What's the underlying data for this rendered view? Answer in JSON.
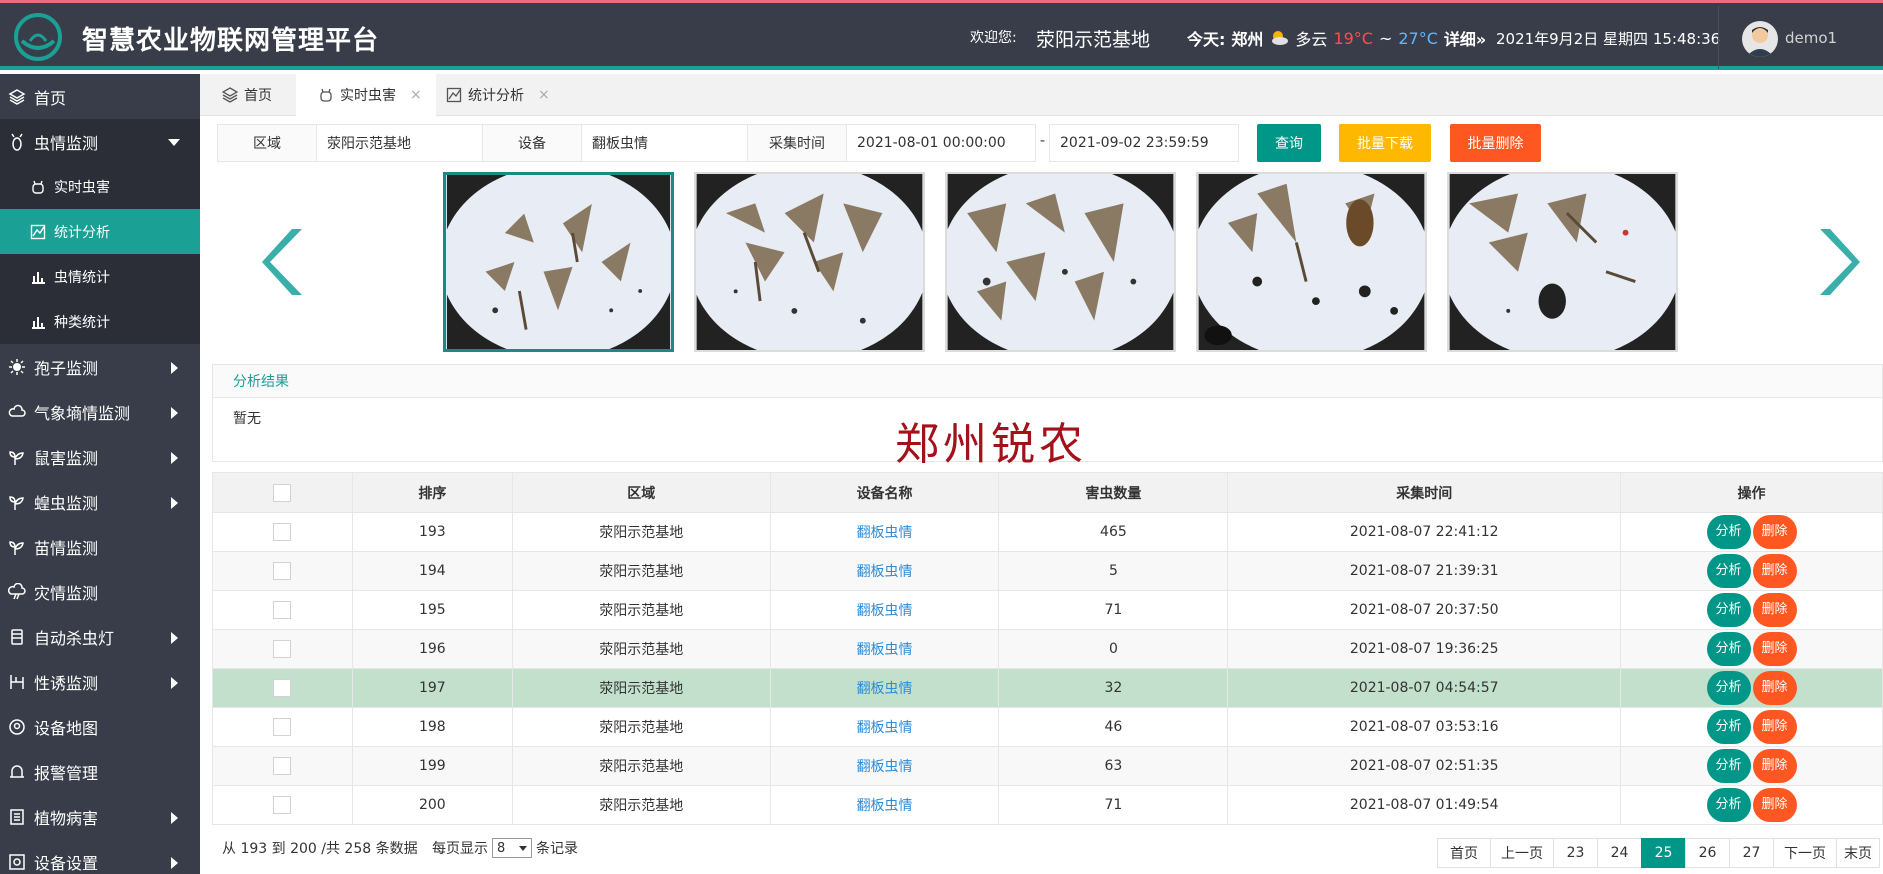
{
  "header": {
    "title": "智慧农业物联网管理平台",
    "welcome": "欢迎您:",
    "site": "荥阳示范基地",
    "today_label": "今天:",
    "city": "郑州",
    "weather": "多云",
    "temp_low": "19°C",
    "temp_sep": "~",
    "temp_high": "27°C",
    "detail": "详细»",
    "date": "2021年9月2日",
    "weekday": "星期四",
    "time": "15:48:36",
    "user": "demo1"
  },
  "sidebar": {
    "items": [
      {
        "label": "首页",
        "icon": "layers-icon"
      },
      {
        "label": "虫情监测",
        "icon": "bug-icon",
        "expanded": true
      },
      {
        "label": "孢子监测",
        "icon": "spore-icon"
      },
      {
        "label": "气象墒情监测",
        "icon": "cloud-icon"
      },
      {
        "label": "鼠害监测",
        "icon": "sprout-icon"
      },
      {
        "label": "蝗虫监测",
        "icon": "sprout-icon"
      },
      {
        "label": "苗情监测",
        "icon": "sprout-icon"
      },
      {
        "label": "灾情监测",
        "icon": "storm-icon"
      },
      {
        "label": "自动杀虫灯",
        "icon": "lamp-icon"
      },
      {
        "label": "性诱监测",
        "icon": "trap-icon"
      },
      {
        "label": "设备地图",
        "icon": "map-icon"
      },
      {
        "label": "报警管理",
        "icon": "bell-icon"
      },
      {
        "label": "植物病害",
        "icon": "leaf-icon"
      },
      {
        "label": "设备设置",
        "icon": "settings-icon"
      }
    ],
    "sub_items": [
      {
        "label": "实时虫害",
        "icon": "bug-icon"
      },
      {
        "label": "统计分析",
        "icon": "chart-icon"
      },
      {
        "label": "虫情统计",
        "icon": "bar-chart-icon"
      },
      {
        "label": "种类统计",
        "icon": "bar-chart-icon"
      }
    ]
  },
  "tabs": [
    {
      "label": "首页",
      "icon": "layers-icon"
    },
    {
      "label": "实时虫害",
      "icon": "bug-icon",
      "close": "×"
    },
    {
      "label": "统计分析",
      "icon": "chart-icon",
      "close": "×"
    }
  ],
  "filter": {
    "area_label": "区域",
    "area_value": "荥阳示范基地",
    "device_label": "设备",
    "device_value": "翻板虫情",
    "time_label": "采集时间",
    "start": "2021-08-01 00:00:00",
    "dash": "-",
    "end": "2021-09-02 23:59:59",
    "query": "查询",
    "download": "批量下载",
    "delete": "批量删除"
  },
  "colors": {
    "accent": "#1aa094",
    "header_bg": "#393d49",
    "query_btn": "#009688",
    "download_btn": "#ffb800",
    "delete_btn": "#ff5722",
    "highlight_row": "#c2e0cc"
  },
  "analysis": {
    "title": "分析结果",
    "content": "暂无",
    "watermark": "郑州锐农"
  },
  "table": {
    "headers": [
      "排序",
      "区域",
      "设备名称",
      "害虫数量",
      "采集时间",
      "操作"
    ],
    "analyze": "分析",
    "delete": "删除",
    "rows": [
      {
        "no": "193",
        "area": "荥阳示范基地",
        "device": "翻板虫情",
        "count": "465",
        "time": "2021-08-07 22:41:12"
      },
      {
        "no": "194",
        "area": "荥阳示范基地",
        "device": "翻板虫情",
        "count": "5",
        "time": "2021-08-07 21:39:31"
      },
      {
        "no": "195",
        "area": "荥阳示范基地",
        "device": "翻板虫情",
        "count": "71",
        "time": "2021-08-07 20:37:50"
      },
      {
        "no": "196",
        "area": "荥阳示范基地",
        "device": "翻板虫情",
        "count": "0",
        "time": "2021-08-07 19:36:25"
      },
      {
        "no": "197",
        "area": "荥阳示范基地",
        "device": "翻板虫情",
        "count": "32",
        "time": "2021-08-07 04:54:57"
      },
      {
        "no": "198",
        "area": "荥阳示范基地",
        "device": "翻板虫情",
        "count": "46",
        "time": "2021-08-07 03:53:16"
      },
      {
        "no": "199",
        "area": "荥阳示范基地",
        "device": "翻板虫情",
        "count": "63",
        "time": "2021-08-07 02:51:35"
      },
      {
        "no": "200",
        "area": "荥阳示范基地",
        "device": "翻板虫情",
        "count": "71",
        "time": "2021-08-07 01:49:54"
      }
    ]
  },
  "pager": {
    "info": "从 193 到 200 /共 258 条数据",
    "per_page_prefix": "每页显示",
    "per_page": "8",
    "per_page_suffix": "条记录",
    "pages": [
      "首页",
      "上一页",
      "23",
      "24",
      "25",
      "26",
      "27",
      "下一页",
      "末页"
    ],
    "current": "25"
  }
}
